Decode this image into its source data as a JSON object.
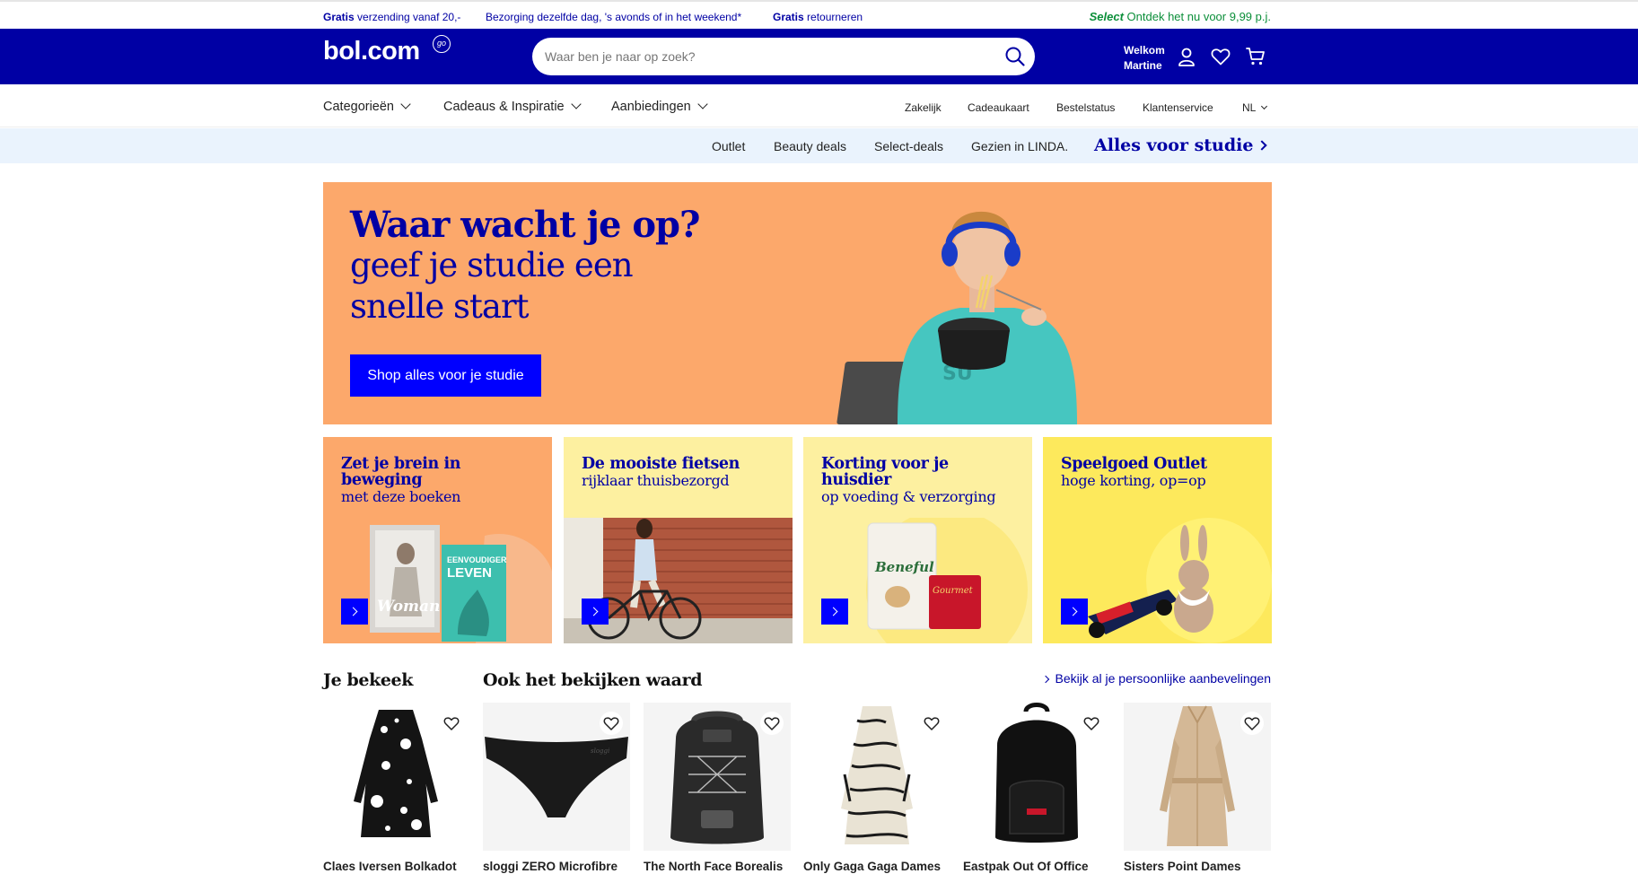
{
  "usp": [
    {
      "bold": "Gratis",
      "text": " verzending vanaf 20,-"
    },
    {
      "bold": "",
      "text": "Bezorging dezelfde dag, 's avonds of in het weekend*"
    },
    {
      "bold": "Gratis",
      "text": " retourneren"
    }
  ],
  "select": {
    "bold": "Select",
    "text": " Ontdek het nu voor 9,99 p.j."
  },
  "header": {
    "logo": "bol.com",
    "logo_badge": "go",
    "search_placeholder": "Waar ben je naar op zoek?",
    "welcome_line1": "Welkom",
    "welcome_line2": "Martine"
  },
  "nav": {
    "main": [
      "Categorieën",
      "Cadeaus & Inspiratie",
      "Aanbiedingen"
    ],
    "right": [
      "Zakelijk",
      "Cadeaukaart",
      "Bestelstatus",
      "Klantenservice",
      "NL"
    ]
  },
  "subnav": {
    "items": [
      "Outlet",
      "Beauty deals",
      "Select-deals",
      "Gezien in LINDA."
    ],
    "feature": "Alles voor studie"
  },
  "hero": {
    "title": "Waar wacht je op?",
    "subtitle": "geef je studie een snelle start",
    "button": "Shop alles voor je studie",
    "bg": "#fca86b"
  },
  "tiles": [
    {
      "title": "Zet je brein in beweging",
      "sub": "met deze boeken",
      "bg": "#fca86b",
      "book1": "Woman",
      "book2_line1": "EENVOUDIGER",
      "book2_line2": "LEVEN"
    },
    {
      "title": "De mooiste fietsen",
      "sub": "rijklaar thuisbezorgd",
      "bg": "#fdf0a0"
    },
    {
      "title": "Korting voor je huisdier",
      "sub": "op voeding & verzorging",
      "bg": "#fdf0a0",
      "pack1": "Beneful",
      "pack2": "Gourmet"
    },
    {
      "title": "Speelgoed Outlet",
      "sub": "hoge korting, op=op",
      "bg": "#fde95c"
    }
  ],
  "sections": {
    "viewed": "Je bekeek",
    "recommended": "Ook het bekijken waard",
    "reco_link": "Bekijk al je persoonlijke aanbevelingen"
  },
  "products": [
    {
      "name": "Claes Iversen Bolkadot"
    },
    {
      "name": "sloggi ZERO Microfibre"
    },
    {
      "name": "The North Face Borealis"
    },
    {
      "name": "Only Gaga Gaga Dames"
    },
    {
      "name": "Eastpak Out Of Office"
    },
    {
      "name": "Sisters Point Dames"
    }
  ],
  "colors": {
    "brand": "#0000a4",
    "cta": "#0000ff",
    "select_green": "#0c8f3a",
    "subnav_bg": "#eaf3fd"
  }
}
